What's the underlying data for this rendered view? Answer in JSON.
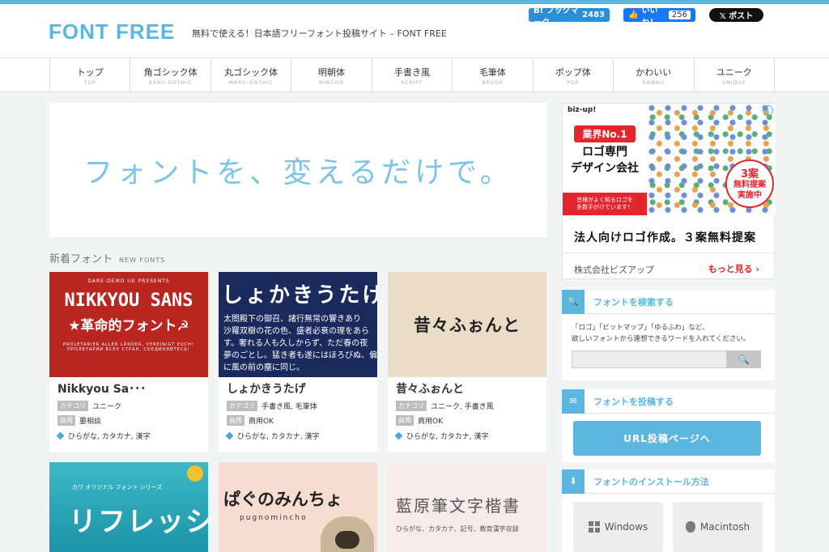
{
  "header": {
    "logo": "FONT FREE",
    "tagline": "無料で使える！日本語フリーフォント投稿サイト – FONT FREE",
    "share": {
      "hatena_label": "B! ブックマーク",
      "hatena_count": "2483",
      "fb_label": "いいね！",
      "fb_count": "256",
      "x_label": "𝕏 ポスト"
    }
  },
  "nav": [
    {
      "ja": "トップ",
      "en": "TOP"
    },
    {
      "ja": "角ゴシック体",
      "en": "KAKU-GOTHIC"
    },
    {
      "ja": "丸ゴシック体",
      "en": "MARU-GOTHIC"
    },
    {
      "ja": "明朝体",
      "en": "MINCHO"
    },
    {
      "ja": "手書き風",
      "en": "SCRIPT"
    },
    {
      "ja": "毛筆体",
      "en": "BRUSH"
    },
    {
      "ja": "ポップ体",
      "en": "POP"
    },
    {
      "ja": "かわいい",
      "en": "KAWAII"
    },
    {
      "ja": "ユニーク",
      "en": "UNIQUE"
    }
  ],
  "hero": {
    "copy": "フォントを、変えるだけで。"
  },
  "new_fonts": {
    "ja": "新着フォント",
    "en": "NEW FONTS"
  },
  "labels": {
    "category": "カテゴリ",
    "commercial": "商用"
  },
  "cards": [
    {
      "title": "Nikkyou Sa･･･",
      "category": "ユニーク",
      "commercial": "要相談",
      "tags": "ひらがな, カタカナ, 漢字",
      "thumb": {
        "small": "DARE-DEMO IIE PRESENTS",
        "big": "NIKKYOU SANS",
        "big2": "★革命的フォント☭",
        "small2": "PROLETARIER ALLER LÄNDER, VEREINIGT EUCH! ПРОЛЕТАРИИ ВСЕХ СТРАН, СОЕДИНЯЙТЕСЬ!"
      }
    },
    {
      "title": "しょかきうたげ",
      "category": "手書き風, 毛筆体",
      "commercial": "商用OK",
      "tags": "ひらがな, カタカナ, 漢字",
      "thumb": {
        "big": "しょかきうたげ",
        "line1": "太閤殿下の御召、諸行無常の響きあり",
        "line2": "沙羅双樹の花の色、盛者必衰の理をあら",
        "line3": "す。奢れる人も久しからず、ただ春の夜",
        "line4": "夢のごとし。猛き者も遂にはほろびぬ、偏",
        "line5": "に風の前の塵に同じ。"
      }
    },
    {
      "title": "昔々ふぉんと",
      "category": "ユニーク, 手書き風",
      "commercial": "商用OK",
      "tags": "ひらがな, カタカナ, 漢字",
      "thumb": {
        "big": "昔々ふぉんと"
      }
    },
    {
      "thumb": {
        "small": "カワ オリジナル フォント シリーズ",
        "big": "リフレッシュ"
      }
    },
    {
      "thumb": {
        "big": "ぱぐのみんちょ",
        "small": "pugnomincho"
      }
    },
    {
      "thumb": {
        "big": "藍原筆文字楷書",
        "small": "ひらがな、カタカナ、記号、教育漢字収録"
      }
    }
  ],
  "ad": {
    "brand": "biz-up!",
    "no1": "業界No.1",
    "logo_line1": "ロゴ専門",
    "logo_line2": "デザイン会社",
    "red_line1": "皆様がよく知るロゴを",
    "red_line2": "多数手がけています！",
    "offer_line1": "3案",
    "offer_line2": "無料提案",
    "offer_line3": "実施中",
    "headline": "法人向けロゴ作成。３案無料提案",
    "company": "株式会社ビズアップ",
    "more": "もっと見る ›"
  },
  "search_widget": {
    "title": "フォントを検索する",
    "desc_line1": "「ロゴ」「ビットマップ」「ゆるふわ」など、",
    "desc_line2": "欲しいフォントから連想できるワードを入れてください。",
    "placeholder": ""
  },
  "post_widget": {
    "title": "フォントを投稿する",
    "button": "URL投稿ページへ"
  },
  "install_widget": {
    "title": "フォントのインストール方法",
    "windows": "Windows",
    "mac": "Macintosh"
  }
}
